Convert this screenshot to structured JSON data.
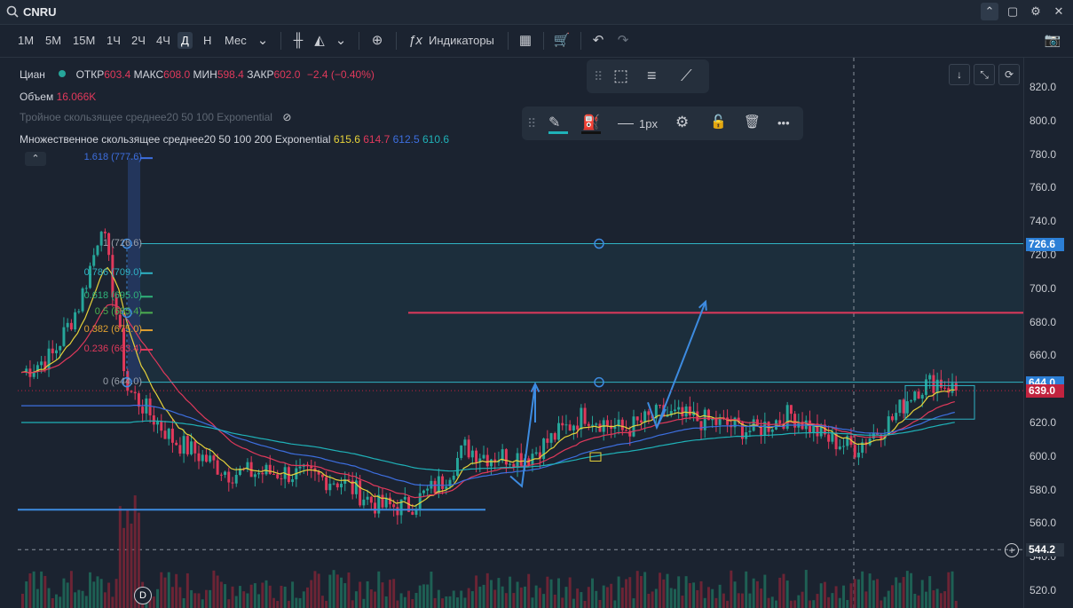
{
  "topbar": {
    "symbol": "CNRU"
  },
  "timeframes": [
    "1М",
    "5М",
    "15М",
    "1Ч",
    "2Ч",
    "4Ч",
    "Д",
    "Н",
    "Мес"
  ],
  "selected_timeframe": "Д",
  "toolbar": {
    "indicators_label": "Индикаторы"
  },
  "legend": {
    "name": "Циан",
    "open_label": "ОТКР",
    "open": "603.4",
    "high_label": "МАКС",
    "high": "608.0",
    "low_label": "МИН",
    "low": "598.4",
    "close_label": "ЗАКР",
    "close": "602.0",
    "change": "−2.4 (−0.40%)",
    "volume_label": "Объем",
    "volume": "16.066K",
    "tema_label": "Тройное скользящее среднее20 50 100 Exponential",
    "mma_label": "Множественное скользящее среднее20 50 100 200 Exponential",
    "mma_values": [
      "615.6",
      "614.7",
      "612.5",
      "610.6"
    ],
    "mma_colors": [
      "#e6d23a",
      "#e0395b",
      "#3d6fe0",
      "#1fb2b8"
    ]
  },
  "drawing_toolbar": {
    "width_label": "1px"
  },
  "fib_labels": [
    {
      "text": "1.618 (777.6)",
      "color": "#3d6fe0"
    },
    {
      "text": "1 (726.6)",
      "color": "#9aa1ab"
    },
    {
      "text": "0.786 (709.0)",
      "color": "#2fb3c4"
    },
    {
      "text": "0.618 (695.0)",
      "color": "#2fb37a"
    },
    {
      "text": "0.5 (685.4)",
      "color": "#4caf50"
    },
    {
      "text": "0.382 (675.0)",
      "color": "#e0a030"
    },
    {
      "text": "0.236 (663.4)",
      "color": "#e0395b"
    },
    {
      "text": "0 (644.0)",
      "color": "#9aa1ab"
    }
  ],
  "price_scale": {
    "ticks": [
      "820.0",
      "800.0",
      "780.0",
      "760.0",
      "740.0",
      "720.0",
      "700.0",
      "680.0",
      "660.0",
      "640.0",
      "620.0",
      "600.0",
      "580.0",
      "560.0",
      "540.0",
      "520.0"
    ],
    "tags": [
      {
        "text": "726.6",
        "color": "#2c7fd6"
      },
      {
        "text": "644.0",
        "color": "#2c7fd6"
      },
      {
        "text": "639.0",
        "color": "#c2233f"
      },
      {
        "text": "544.2",
        "color": "#2a3441"
      }
    ]
  },
  "chart_data": {
    "type": "candlestick",
    "y_axis_range": [
      515,
      830
    ],
    "horizontal_levels": [
      {
        "value": 726.6,
        "color": "#2fb3c4"
      },
      {
        "value": 685.4,
        "color": "#e0395b"
      },
      {
        "value": 644.0,
        "color": "#2fb3c4"
      },
      {
        "value": 568.0,
        "color": "#3d8be0"
      }
    ],
    "crosshair_price": 544.2,
    "colors": {
      "up": "#26a69a",
      "down": "#e0395b"
    },
    "last_close": 639.0
  },
  "event_marker": "D"
}
